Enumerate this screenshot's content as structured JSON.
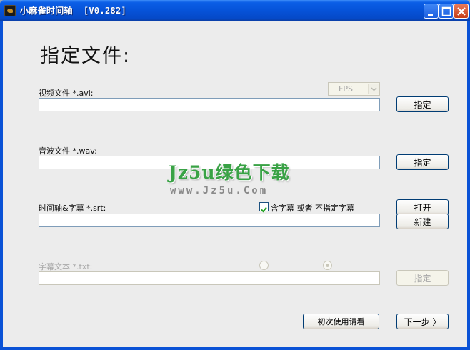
{
  "window": {
    "title": "小麻雀时间轴  [V0.282]",
    "controls": {
      "minimize_icon": "minimize-icon",
      "maximize_icon": "maximize-icon",
      "close_icon": "close-icon"
    }
  },
  "main": {
    "heading": "指定文件:",
    "video": {
      "label": "视频文件 *.avi:",
      "value": "",
      "button": "指定",
      "fps_select": "FPS"
    },
    "audio": {
      "label": "音波文件 *.wav:",
      "value": "",
      "button": "指定"
    },
    "timeline": {
      "label": "时间轴&字幕 *.srt:",
      "checkbox_label": "含字幕 或者 不指定字幕",
      "checked": true,
      "value": "",
      "open_button": "打开",
      "new_button": "新建"
    },
    "subtitle_text": {
      "label": "字幕文本 *.txt:",
      "value": "",
      "button": "指定"
    },
    "first_use_button": "初次使用请看",
    "next_button": "下一步 〉"
  },
  "watermark": {
    "title": "Jz5u绿色下载",
    "url": "www.Jz5u.Com"
  },
  "colors": {
    "titlebar": "#0653d9",
    "client_bg": "#ececec",
    "field_border": "#7f9db9",
    "watermark_green": "#39a245"
  }
}
